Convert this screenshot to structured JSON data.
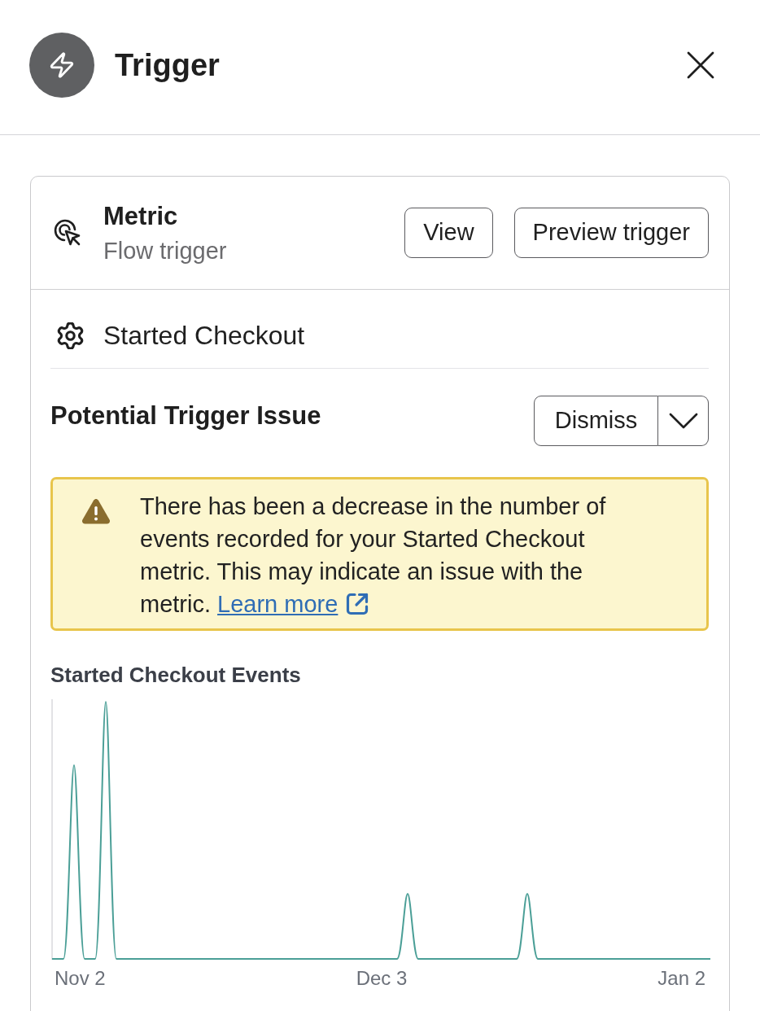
{
  "panel": {
    "title": "Trigger"
  },
  "trigger_card": {
    "trigger_type": "Metric",
    "subtitle": "Flow trigger",
    "buttons": [
      "View",
      "Preview trigger"
    ],
    "metric": "Started Checkout",
    "issue": {
      "title": "Potential Trigger Issue",
      "dismiss_button": "Dismiss",
      "warning": {
        "message": "There has been a decrease in the number of events recorded for your Started Checkout metric. This may indicate an issue with the metric.",
        "link": "Learn more"
      }
    },
    "chart": {
      "title": "Started Checkout Events",
      "x_labels": [
        "Nov 2",
        "Dec 3",
        "Jan 2"
      ]
    }
  }
}
